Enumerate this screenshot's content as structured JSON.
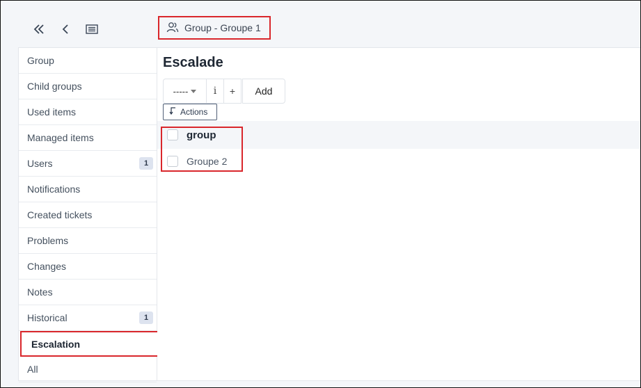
{
  "header": {
    "breadcrumb_label": "Group - Groupe 1",
    "icons": [
      "double-chevron-left-icon",
      "chevron-left-icon",
      "list-icon",
      "users-icon"
    ]
  },
  "sidebar": {
    "items": [
      {
        "label": "Group",
        "badge": null
      },
      {
        "label": "Child groups",
        "badge": null
      },
      {
        "label": "Used items",
        "badge": null
      },
      {
        "label": "Managed items",
        "badge": null
      },
      {
        "label": "Users",
        "badge": "1"
      },
      {
        "label": "Notifications",
        "badge": null
      },
      {
        "label": "Created tickets",
        "badge": null
      },
      {
        "label": "Problems",
        "badge": null
      },
      {
        "label": "Changes",
        "badge": null
      },
      {
        "label": "Notes",
        "badge": null
      },
      {
        "label": "Historical",
        "badge": "1"
      },
      {
        "label": "Escalation",
        "badge": null,
        "active": true
      },
      {
        "label": "All",
        "badge": null
      }
    ]
  },
  "main": {
    "title": "Escalade",
    "select_value": "-----",
    "info_label": "i",
    "plus_label": "+",
    "add_label": "Add",
    "actions_label": "Actions",
    "table": {
      "header": "group",
      "rows": [
        "Groupe 2"
      ]
    }
  },
  "colors": {
    "highlight": "#d9262b",
    "badge_bg": "#dde3ef",
    "page_bg": "#f4f6f9"
  }
}
